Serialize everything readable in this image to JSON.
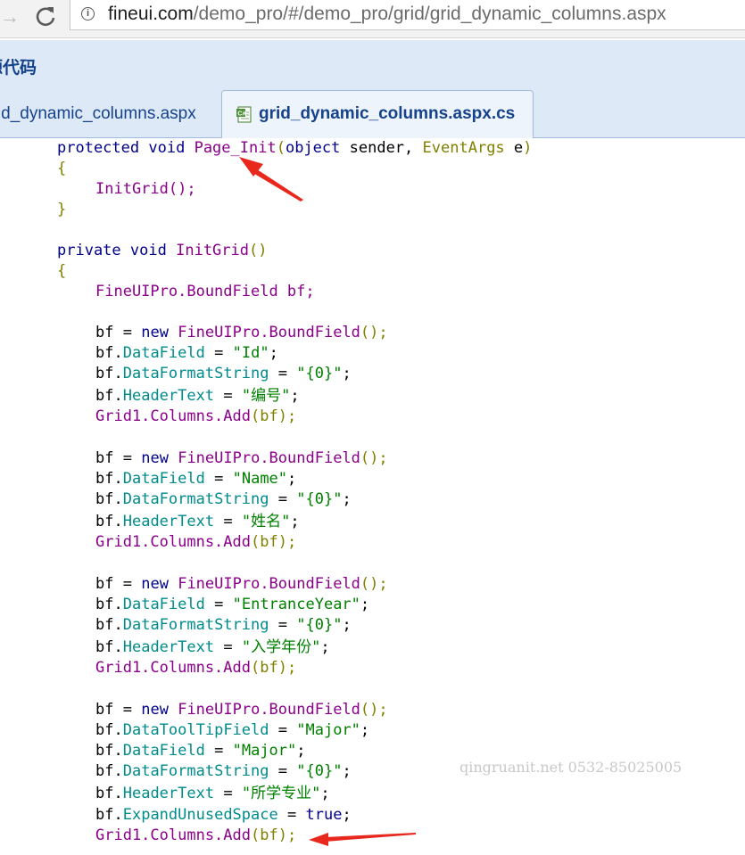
{
  "browser": {
    "forward_glyph": "→",
    "url_host": "fineui.com",
    "url_path": "/demo_pro/#/demo_pro/grid/grid_dynamic_columns.aspx"
  },
  "panel": {
    "title": "源代码",
    "tabs": [
      {
        "label": "grid_dynamic_columns.aspx",
        "active": false
      },
      {
        "label": "grid_dynamic_columns.aspx.cs",
        "active": true
      }
    ]
  },
  "code": {
    "page_init": [
      "protected",
      "void",
      "Page_Init",
      "(",
      "object",
      "sender",
      ",",
      "EventArgs",
      "e",
      ")"
    ],
    "open_brace": "{",
    "close_brace": "}",
    "initgrid_call": "InitGrid();",
    "initgrid_decl": [
      "private",
      "void",
      "InitGrid",
      "()"
    ],
    "bf_decl": "FineUIPro.BoundField bf;",
    "blocks": [
      {
        "datafield": "\"Id\"",
        "format": "\"{0}\"",
        "header": "\"编号\""
      },
      {
        "datafield": "\"Name\"",
        "format": "\"{0}\"",
        "header": "\"姓名\""
      },
      {
        "datafield": "\"EntranceYear\"",
        "format": "\"{0}\"",
        "header": "\"入学年份\""
      },
      {
        "tooltip": "\"Major\"",
        "datafield": "\"Major\"",
        "format": "\"{0}\"",
        "header": "\"所学专业\"",
        "expand": "true"
      }
    ],
    "tokens": {
      "bf": "bf",
      "eq": "=",
      "new": "new",
      "boundfield_ctor": "FineUIPro.BoundField",
      "call_end": "();",
      "dot": ".",
      "semi": ";",
      "DataField": "DataField",
      "DataFormatString": "DataFormatString",
      "HeaderText": "HeaderText",
      "DataToolTipField": "DataToolTipField",
      "ExpandUnusedSpace": "ExpandUnusedSpace",
      "grid_add_prefix": "Grid1.Columns.Add",
      "grid_add_arg": "(bf);"
    }
  },
  "watermark": "qingruanit.net 0532-85025005",
  "colors": {
    "keyword": "#00008b",
    "paren": "#808000",
    "string": "#008000",
    "member": "#008b8b",
    "type": "#8b008b",
    "tab_text": "#15428b",
    "annotation_arrow": "#e8281d"
  }
}
